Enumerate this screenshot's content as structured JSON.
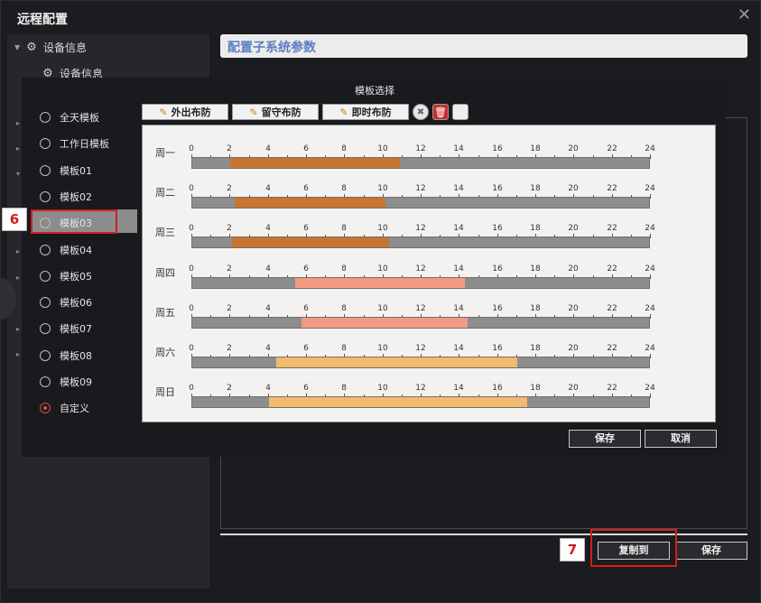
{
  "window": {
    "title": "远程配置",
    "close_label": "✕"
  },
  "tree": {
    "root_label": "设备信息",
    "child_label": "设备信息"
  },
  "subsystem": {
    "title": "配置子系统参数"
  },
  "template_dialog": {
    "title": "模板选择",
    "templates": [
      {
        "label": "全天模板",
        "checked": false
      },
      {
        "label": "工作日模板",
        "checked": false
      },
      {
        "label": "模板01",
        "checked": false
      },
      {
        "label": "模板02",
        "checked": false
      },
      {
        "label": "模板03",
        "checked": false,
        "selected": true
      },
      {
        "label": "模板04",
        "checked": false
      },
      {
        "label": "模板05",
        "checked": false
      },
      {
        "label": "模板06",
        "checked": false
      },
      {
        "label": "模板07",
        "checked": false
      },
      {
        "label": "模板08",
        "checked": false
      },
      {
        "label": "模板09",
        "checked": false
      },
      {
        "label": "自定义",
        "checked": true
      }
    ],
    "toolbar": {
      "arm_away": "外出布防",
      "arm_stay": "留守布防",
      "arm_instant": "即时布防"
    },
    "axis_ticks": [
      "0",
      "2",
      "4",
      "6",
      "8",
      "10",
      "12",
      "14",
      "16",
      "18",
      "20",
      "22",
      "24"
    ],
    "days": [
      {
        "label": "周一",
        "start": 2.0,
        "end": 10.9,
        "color": "#c8762f"
      },
      {
        "label": "周二",
        "start": 2.2,
        "end": 10.1,
        "color": "#c8762f"
      },
      {
        "label": "周三",
        "start": 2.1,
        "end": 10.3,
        "color": "#c8762f"
      },
      {
        "label": "周四",
        "start": 5.4,
        "end": 14.3,
        "color": "#f29b82"
      },
      {
        "label": "周五",
        "start": 5.7,
        "end": 14.4,
        "color": "#f29b82"
      },
      {
        "label": "周六",
        "start": 4.4,
        "end": 17.0,
        "color": "#f2bb6e"
      },
      {
        "label": "周日",
        "start": 4.0,
        "end": 17.5,
        "color": "#f2bb6e"
      }
    ],
    "save_label": "保存",
    "cancel_label": "取消"
  },
  "footer": {
    "copy_to_label": "复制到",
    "save_label": "保存"
  },
  "annotations": {
    "step6": "6",
    "step7": "7"
  },
  "colors": {
    "accent_blue": "#5a7ec2",
    "highlight_red": "#d01e1e"
  }
}
